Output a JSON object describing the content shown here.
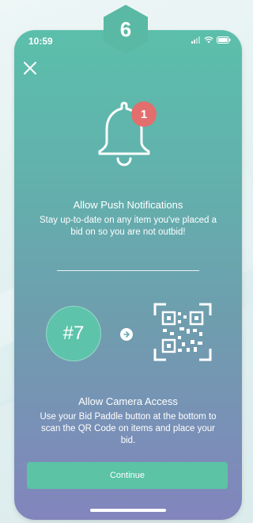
{
  "step": {
    "number": "6"
  },
  "status_bar": {
    "time": "10:59"
  },
  "notifications": {
    "badge_count": "1",
    "title": "Allow Push Notifications",
    "body": "Stay up-to-date on any item you've placed a bid on so you are not outbid!"
  },
  "camera": {
    "paddle_label": "#7",
    "title": "Allow Camera Access",
    "body": "Use your Bid Paddle button at the bottom to scan the QR Code on items and place your bid."
  },
  "continue_button": {
    "label": "Continue"
  },
  "icons": {
    "close": "close-icon",
    "bell": "bell-icon",
    "arrow": "arrow-right-icon",
    "qr": "qr-code-icon",
    "signal": "signal-icon",
    "wifi": "wifi-icon",
    "battery": "battery-icon"
  },
  "colors": {
    "accent": "#5cc3a4",
    "badge": "#e36e6e",
    "gradient_top": "#5bbfab",
    "gradient_bottom": "#8285bd"
  }
}
